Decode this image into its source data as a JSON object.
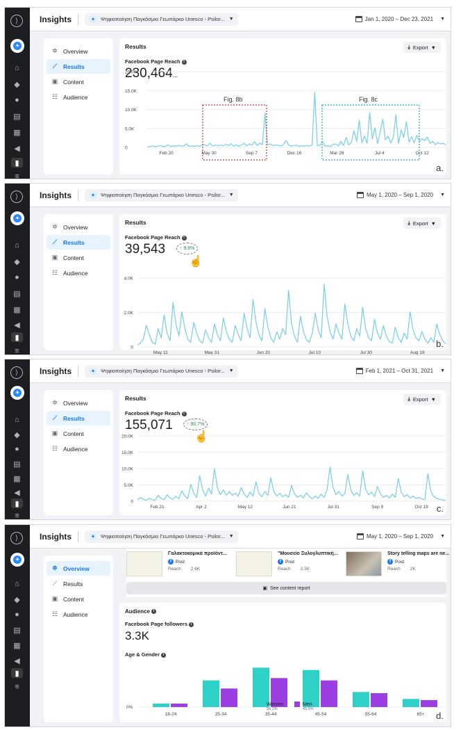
{
  "header": {
    "title": "Insights",
    "page_name": "Ψηφιοποίηση Παγκόσμιο Γεωπάρκο Unesco - Psilor..."
  },
  "nav": [
    "Overview",
    "Results",
    "Content",
    "Audience"
  ],
  "labels": {
    "results": "Results",
    "export": "Export",
    "reach_label": "Facebook Page Reach"
  },
  "panels": [
    {
      "letter": "a.",
      "date_range": "Jan 1, 2020 – Dec 23, 2021",
      "reach": "230,464",
      "reach_suffix": "...",
      "annotations": [
        "Fig. 8b",
        "Fig. 8c"
      ]
    },
    {
      "letter": "b.",
      "date_range": "May 1, 2020 – Sep 1, 2020",
      "reach": "39,543",
      "trend": "9.8%"
    },
    {
      "letter": "c.",
      "date_range": "Feb 1, 2021 – Oct 31, 2021",
      "reach": "155,071",
      "trend": "90.7%"
    },
    {
      "letter": "d.",
      "date_range": "May 1, 2020 – Sep 1, 2020"
    }
  ],
  "posts": [
    {
      "title": "Γαλακτοκομικά προϊόντ...",
      "type": "Post",
      "reach_label": "Reach",
      "reach": "2.6K"
    },
    {
      "title": "\"Μουσείο Ξυλογλυπτική...",
      "type": "Post",
      "reach_label": "Reach",
      "reach": "2.5K"
    },
    {
      "title": "Story telling maps are ne...",
      "type": "Post",
      "reach_label": "Reach",
      "reach": "2K"
    }
  ],
  "see_content_report": "See content report",
  "audience": {
    "title": "Audience",
    "followers_label": "Facebook Page followers",
    "followers": "3.3K",
    "age_gender_label": "Age & Gender"
  },
  "colors": {
    "accent": "#1877f2",
    "line": "#7fcfe8",
    "women": "#2fd0c8",
    "men": "#9b3fe3",
    "fig8b": "#c0392b",
    "fig8c": "#1aa3c7"
  },
  "chart_data": [
    {
      "type": "line",
      "series": [
        {
          "values": [
            160,
            200,
            380,
            200,
            300,
            520,
            240,
            260,
            700,
            220,
            400,
            320,
            560,
            300,
            420,
            900,
            300,
            380,
            260,
            440,
            300,
            560,
            700,
            340,
            1100,
            360,
            600,
            460,
            680,
            380,
            820,
            440,
            980,
            360,
            700,
            300,
            620,
            1100,
            420,
            900,
            600,
            1500,
            500,
            1100,
            700,
            9000,
            600,
            900,
            480,
            640,
            560,
            380,
            720,
            1800,
            640,
            320,
            460,
            600,
            260,
            420,
            300,
            520,
            380,
            640,
            14500,
            400,
            600,
            1600,
            300,
            460,
            240,
            780,
            900,
            360,
            1600,
            500,
            2600,
            640,
            1400,
            4400,
            1600,
            7200,
            1200,
            3000,
            1100,
            9200,
            2200,
            5200,
            1000,
            4200,
            7400,
            2000,
            3000,
            1200,
            2600,
            8600,
            1000,
            4600,
            2600,
            6800,
            1400,
            2800,
            1200,
            3200,
            1600,
            2300,
            1800,
            2700,
            1100,
            1600,
            700,
            1300,
            900,
            1100,
            600
          ]
        }
      ],
      "x_ticks": [
        "Feb 20",
        "May 30",
        "Sep 7",
        "Dec 16",
        "Mar 26",
        "Jul 4",
        "Oct 12"
      ],
      "y_ticks": [
        "0",
        "5.0K",
        "10.0K",
        "15.0K",
        "20.0K"
      ],
      "ylim": [
        0,
        20000
      ]
    },
    {
      "type": "line",
      "series": [
        {
          "values": [
            120,
            260,
            500,
            1400,
            800,
            300,
            180,
            1200,
            600,
            2100,
            900,
            400,
            2900,
            1500,
            700,
            2300,
            1200,
            500,
            300,
            1600,
            900,
            400,
            250,
            1100,
            600,
            300,
            1500,
            800,
            400,
            1900,
            1000,
            500,
            300,
            1400,
            800,
            400,
            2200,
            1200,
            600,
            3100,
            1600,
            800,
            400,
            2500,
            1300,
            600,
            300,
            1000,
            500,
            1200,
            800,
            3700,
            1500,
            700,
            300,
            2000,
            1000,
            500,
            300,
            900,
            2200,
            1100,
            600,
            4100,
            2000,
            1000,
            500,
            1500,
            900,
            500,
            2800,
            1500,
            700,
            400,
            1200,
            700,
            2600,
            1200,
            600,
            400,
            1800,
            900,
            500,
            1400,
            700,
            350,
            250,
            1300,
            600,
            300,
            900,
            500,
            2300,
            1100,
            600,
            400,
            1000,
            500,
            250,
            600,
            300,
            1500,
            800,
            400,
            200
          ]
        }
      ],
      "x_ticks": [
        "May 11",
        "May 31",
        "Jun 20",
        "Jul 10",
        "Jul 30",
        "Aug 19"
      ],
      "y_ticks": [
        "0",
        "2.0K",
        "4.0K"
      ],
      "ylim": [
        0,
        4500
      ]
    },
    {
      "type": "line",
      "series": [
        {
          "values": [
            400,
            1200,
            600,
            300,
            900,
            500,
            300,
            1800,
            800,
            500,
            2000,
            1000,
            600,
            1500,
            800,
            3200,
            1600,
            800,
            5200,
            2500,
            1200,
            7800,
            3500,
            1600,
            4000,
            2200,
            10000,
            4000,
            2000,
            3500,
            1800,
            3000,
            1800,
            2500,
            1500,
            4200,
            2200,
            1200,
            2800,
            1600,
            6000,
            2400,
            1400,
            3000,
            1800,
            7200,
            3000,
            1600,
            2400,
            1400,
            2000,
            1200,
            4800,
            2200,
            1200,
            1800,
            1000,
            2600,
            1400,
            800,
            1600,
            900,
            2200,
            1200,
            3600,
            10500,
            4200,
            2000,
            3000,
            1600,
            2400,
            8200,
            3400,
            1800,
            2600,
            1600,
            9300,
            3800,
            1900,
            2800,
            1400,
            4500,
            2200,
            1200,
            1800,
            1000,
            2200,
            1200,
            7000,
            2800,
            1400,
            2000,
            1000,
            1600,
            800,
            1200,
            700,
            600,
            8500,
            3000,
            1400,
            900,
            600,
            400,
            300
          ]
        }
      ],
      "x_ticks": [
        "Feb 21",
        "Apr 2",
        "May 12",
        "Jun 21",
        "Jul 31",
        "Sep 9",
        "Oct 19"
      ],
      "y_ticks": [
        "0",
        "5.0K",
        "10.0K",
        "15.0K",
        "20.0K"
      ],
      "ylim": [
        0,
        20000
      ]
    },
    {
      "type": "bar",
      "categories": [
        "18-24",
        "25-34",
        "35-44",
        "45-54",
        "55-64",
        "65+"
      ],
      "series": [
        {
          "name": "Women",
          "values": [
            1.5,
            11.5,
            17.0,
            16.0,
            6.5,
            3.5
          ]
        },
        {
          "name": "Men",
          "values": [
            1.5,
            8.0,
            12.5,
            11.5,
            6.0,
            3.0
          ]
        }
      ],
      "y_ticks": [
        "0%"
      ],
      "legend": [
        {
          "name": "Women",
          "pct": "56.1%"
        },
        {
          "name": "Men",
          "pct": "43.9%"
        }
      ]
    }
  ]
}
